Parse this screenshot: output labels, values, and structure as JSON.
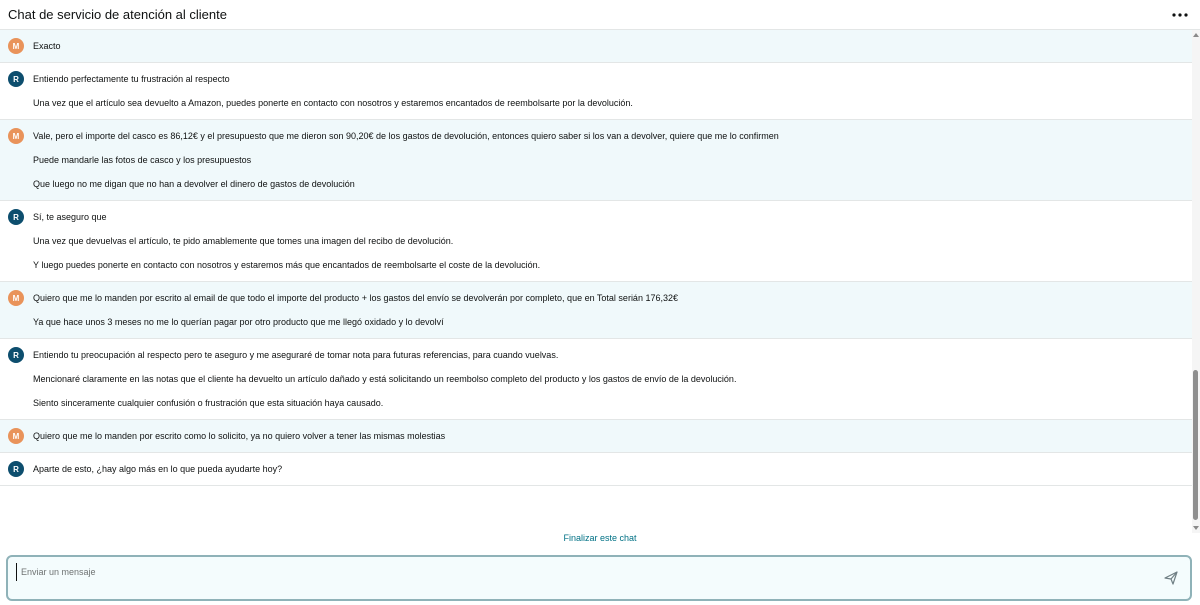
{
  "header": {
    "title": "Chat de servicio de atención al cliente",
    "more_icon": "more-options-icon"
  },
  "messages": [
    {
      "sender": "customer",
      "avatar": "M",
      "lines": [
        "Exacto"
      ]
    },
    {
      "sender": "agent",
      "avatar": "R",
      "lines": [
        "Entiendo perfectamente tu frustración al respecto",
        "Una vez que el artículo sea devuelto a Amazon, puedes ponerte en contacto con nosotros y estaremos encantados de reembolsarte por la devolución."
      ]
    },
    {
      "sender": "customer",
      "avatar": "M",
      "lines": [
        "Vale, pero el importe del casco es 86,12€ y el presupuesto que me dieron son 90,20€ de los gastos de devolución, entonces quiero saber si los van a devolver, quiere que me lo confirmen",
        "Puede mandarle las fotos de casco y los presupuestos",
        "Que luego no me digan que no han a devolver el dinero de gastos de devolución"
      ]
    },
    {
      "sender": "agent",
      "avatar": "R",
      "lines": [
        "Sí, te aseguro que",
        "Una vez que devuelvas el artículo, te pido amablemente que tomes una imagen del recibo de devolución.",
        "Y luego puedes ponerte en contacto con nosotros y estaremos más que encantados de reembolsarte el coste de la devolución."
      ]
    },
    {
      "sender": "customer",
      "avatar": "M",
      "lines": [
        "Quiero que me lo manden por escrito al email de que todo el importe del producto + los gastos del envío se devolverán por completo, que en Total serián 176,32€",
        "Ya que hace unos 3 meses no me lo querían pagar por otro producto que me llegó oxidado y lo devolví"
      ]
    },
    {
      "sender": "agent",
      "avatar": "R",
      "lines": [
        "Entiendo tu preocupación al respecto pero te aseguro y me aseguraré de tomar nota para futuras referencias, para cuando vuelvas.",
        "Mencionaré claramente en las notas que el cliente ha devuelto un artículo dañado y está solicitando un reembolso completo del producto y los gastos de envío de la devolución.",
        "Siento sinceramente cualquier confusión o frustración que esta situación haya causado."
      ]
    },
    {
      "sender": "customer",
      "avatar": "M",
      "lines": [
        "Quiero que me lo manden por escrito como lo solicito, ya no quiero volver a tener las mismas molestias"
      ]
    },
    {
      "sender": "agent",
      "avatar": "R",
      "lines": [
        "Aparte de esto, ¿hay algo más en lo que pueda ayudarte hoy?"
      ]
    }
  ],
  "end_chat_label": "Finalizar este chat",
  "input": {
    "placeholder": "Enviar un mensaje",
    "value": ""
  },
  "colors": {
    "customer_avatar": "#e9935a",
    "agent_avatar": "#0d4e6e",
    "customer_bg": "#f0f9fb",
    "link": "#007185"
  }
}
